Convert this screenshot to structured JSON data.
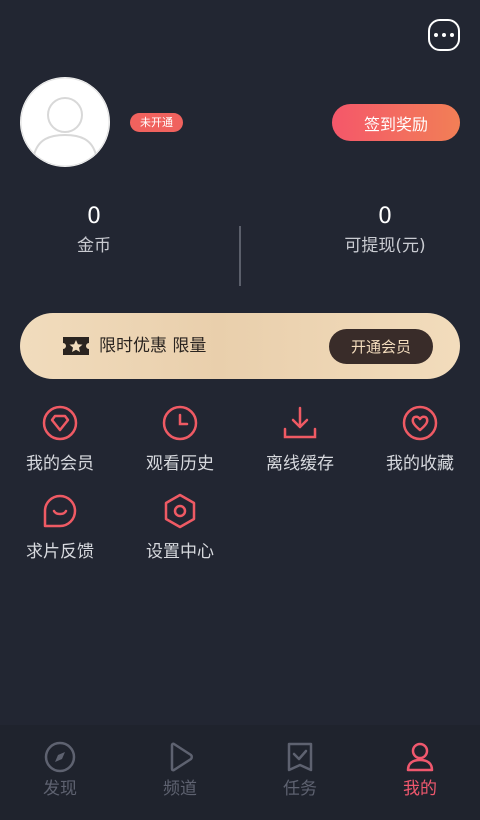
{
  "header": {
    "more_icon": "more-dots-icon"
  },
  "profile": {
    "avatar_icon": "default-avatar-icon",
    "vip_badge": "未开通",
    "signin_button": "签到奖励"
  },
  "stats": [
    {
      "value": "0",
      "label": "金币"
    },
    {
      "value": "0",
      "label": "可提现(元)"
    }
  ],
  "vip_banner": {
    "icon": "star-ticket-icon",
    "text": "限时优惠 限量",
    "button": "开通会员"
  },
  "menu": [
    {
      "label": "我的会员",
      "icon": "diamond-icon"
    },
    {
      "label": "观看历史",
      "icon": "clock-icon"
    },
    {
      "label": "离线缓存",
      "icon": "download-icon"
    },
    {
      "label": "我的收藏",
      "icon": "heart-icon"
    },
    {
      "label": "求片反馈",
      "icon": "feedback-chat-icon"
    },
    {
      "label": "设置中心",
      "icon": "settings-hexagon-icon"
    }
  ],
  "tabs": [
    {
      "label": "发现",
      "icon": "compass-icon",
      "active": false
    },
    {
      "label": "频道",
      "icon": "play-icon",
      "active": false
    },
    {
      "label": "任务",
      "icon": "task-check-icon",
      "active": false
    },
    {
      "label": "我的",
      "icon": "user-icon",
      "active": true
    }
  ],
  "colors": {
    "background": "#222632",
    "accent": "#f0586e",
    "gold": "#f1dcbd",
    "tab_inactive": "#5e6270"
  }
}
